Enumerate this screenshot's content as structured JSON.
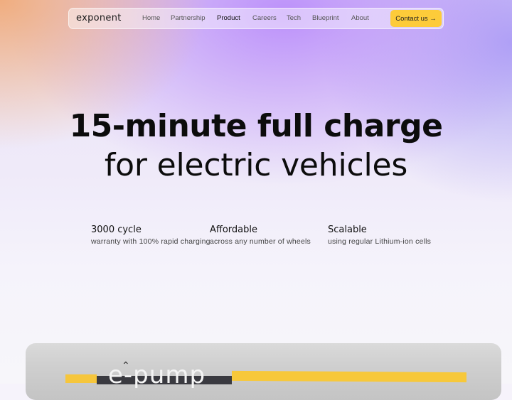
{
  "nav": {
    "logo": "exponent",
    "links": [
      {
        "label": "Home",
        "active": false
      },
      {
        "label": "Partnership",
        "active": false
      },
      {
        "label": "Product",
        "active": true
      },
      {
        "label": "Careers",
        "active": false
      },
      {
        "label": "Tech",
        "active": false
      },
      {
        "label": "Blueprint",
        "active": false
      },
      {
        "label": "About",
        "active": false
      }
    ],
    "contact_label": "Contact us →"
  },
  "hero": {
    "line1": "15-minute full charge",
    "line2": "for electric vehicles"
  },
  "features": [
    {
      "title": "3000 cycle",
      "desc": "warranty with 100% rapid charging"
    },
    {
      "title": "Affordable",
      "desc": "across any number of wheels"
    },
    {
      "title": "Scalable",
      "desc": "using regular Lithium-ion cells"
    }
  ],
  "media": {
    "brand_text": "e-pump",
    "caret_icon": "charge-symbol-icon"
  },
  "colors": {
    "accent": "#fdcb3a",
    "text": "#0c0c0c"
  }
}
